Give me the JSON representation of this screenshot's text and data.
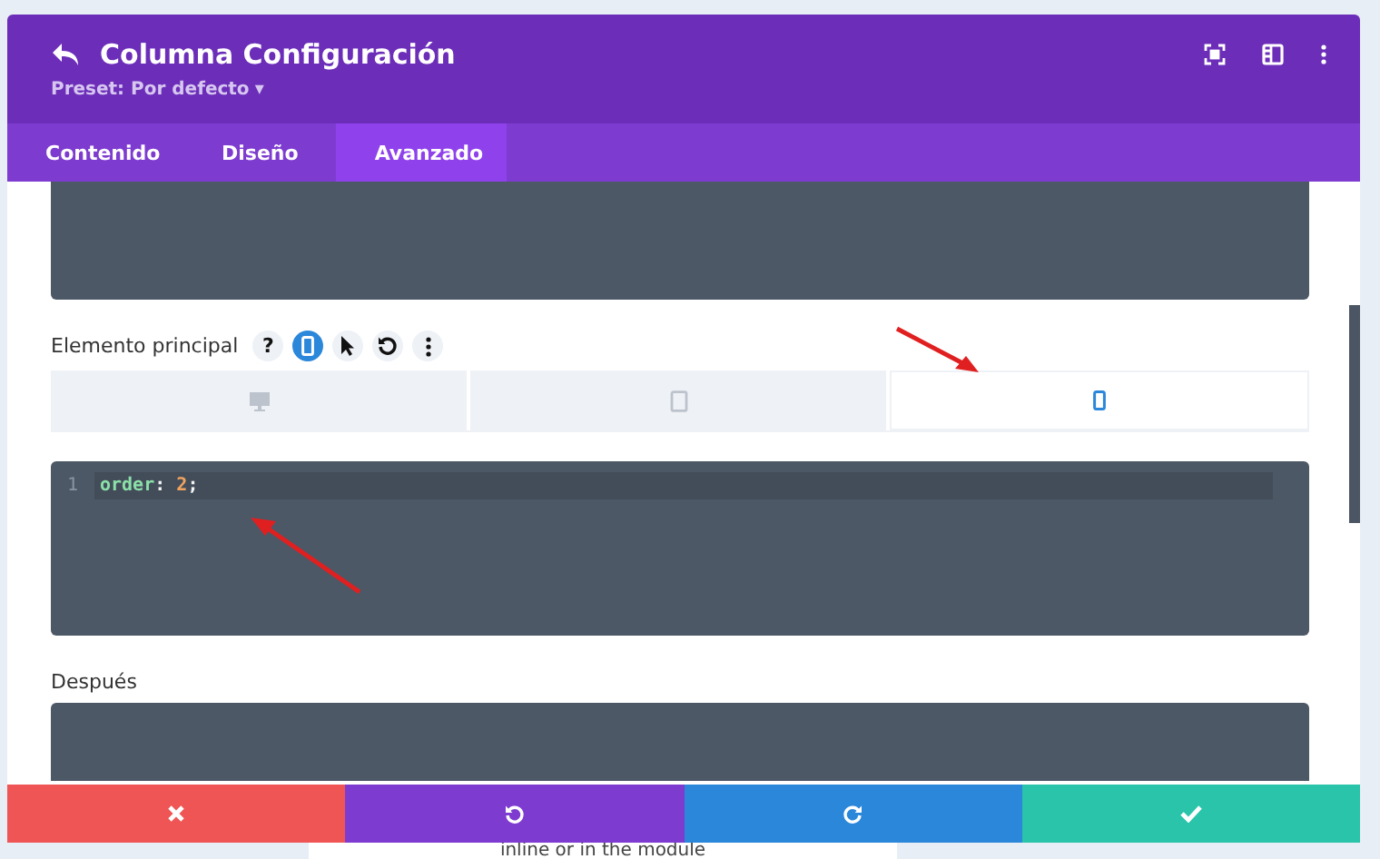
{
  "header": {
    "title": "Columna Configuración",
    "preset": "Preset: Por defecto",
    "preset_caret": "▾"
  },
  "tabs": [
    {
      "label": "Contenido",
      "selected": false
    },
    {
      "label": "Diseño",
      "selected": false
    },
    {
      "label": "Avanzado",
      "selected": true
    }
  ],
  "field": {
    "label": "Elemento principal",
    "help": "?"
  },
  "devices": [
    {
      "kind": "desktop",
      "selected": false
    },
    {
      "kind": "tablet",
      "selected": false
    },
    {
      "kind": "phone",
      "selected": true
    }
  ],
  "code": [
    {
      "number": "1",
      "tokens": [
        {
          "kind": "property",
          "text": "order"
        },
        {
          "kind": "punct",
          "text": ":"
        },
        {
          "kind": "number",
          "text": " 2"
        },
        {
          "kind": "punct",
          "text": ";"
        }
      ]
    }
  ],
  "after_label": "Después",
  "footer": [
    {
      "kind": "cancel"
    },
    {
      "kind": "undo"
    },
    {
      "kind": "redo"
    },
    {
      "kind": "save"
    }
  ],
  "background_text": "inline or in the module"
}
